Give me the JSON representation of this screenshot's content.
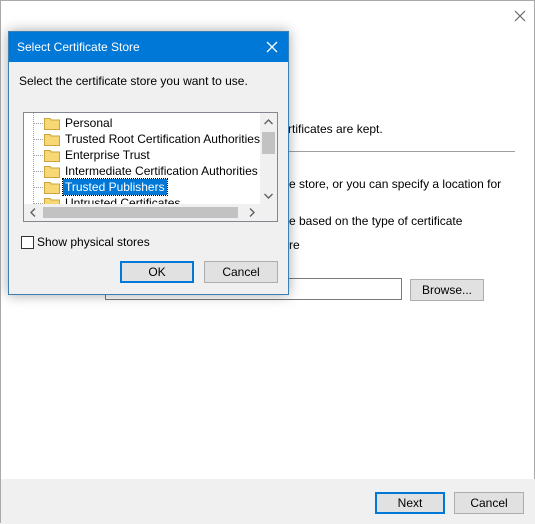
{
  "wizard": {
    "line_kept": "rtificates are kept.",
    "line_store": "e store, or you can specify a location for",
    "line_based": "e based on the type of certificate",
    "line_re": "re",
    "browse_label": "Browse...",
    "next_label": "Next",
    "cancel_label": "Cancel"
  },
  "dialog": {
    "title": "Select Certificate Store",
    "prompt": "Select the certificate store you want to use.",
    "stores": [
      {
        "label": "Personal"
      },
      {
        "label": "Trusted Root Certification Authorities"
      },
      {
        "label": "Enterprise Trust"
      },
      {
        "label": "Intermediate Certification Authorities"
      },
      {
        "label": "Trusted Publishers",
        "selected": true
      },
      {
        "label": "Untrusted Certificates"
      }
    ],
    "show_physical_label": "Show physical stores",
    "show_physical_checked": false,
    "ok_label": "OK",
    "cancel_label": "Cancel"
  },
  "colors": {
    "titlebar": "#0078d7",
    "selection": "#0078d7",
    "folder": "#f8d775"
  }
}
